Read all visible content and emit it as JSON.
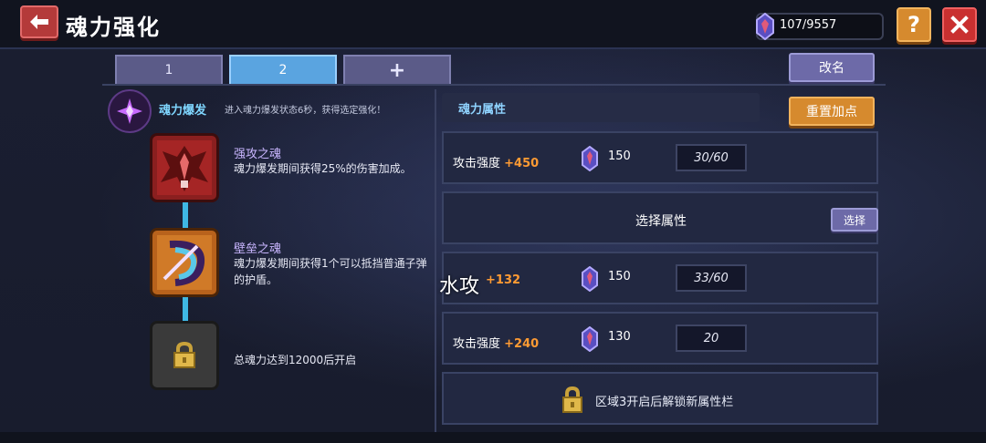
{
  "header": {
    "title": "魂力强化",
    "currency_value": "107/9557",
    "help_label": "?"
  },
  "tabs": [
    {
      "label": "1"
    },
    {
      "label": "2"
    },
    {
      "label": "+"
    }
  ],
  "buttons": {
    "rename": "改名",
    "reset": "重置加点",
    "select": "选择"
  },
  "burst": {
    "name": "魂力爆发",
    "desc": "进入魂力爆发状态6秒，获得选定强化！"
  },
  "skills": [
    {
      "name": "强攻之魂",
      "desc": "魂力爆发期间获得25%的伤害加成。"
    },
    {
      "name": "壁垒之魂",
      "desc": "魂力爆发期间获得1个可以抵挡普通子弹的护盾。"
    }
  ],
  "locked_skill": {
    "desc": "总魂力达到12000后开启"
  },
  "attributes": {
    "title": "魂力属性",
    "rows": [
      {
        "label": "攻击强度",
        "bonus": "+450",
        "cost": "150",
        "level": "30/60"
      },
      {
        "select_text": "选择属性"
      },
      {
        "label": "",
        "bonus": "+132",
        "cost": "150",
        "level": "33/60"
      },
      {
        "label": "攻击强度",
        "bonus": "+240",
        "cost": "130",
        "level": "20"
      }
    ],
    "locked_row_text": "区域3开启后解锁新属性栏"
  },
  "overlay_text": "水攻",
  "colors": {
    "accent_orange": "#ff9b33",
    "tab_active": "#5aa4e0",
    "close_red": "#c93030",
    "cyan_label": "#8fd3ff"
  }
}
